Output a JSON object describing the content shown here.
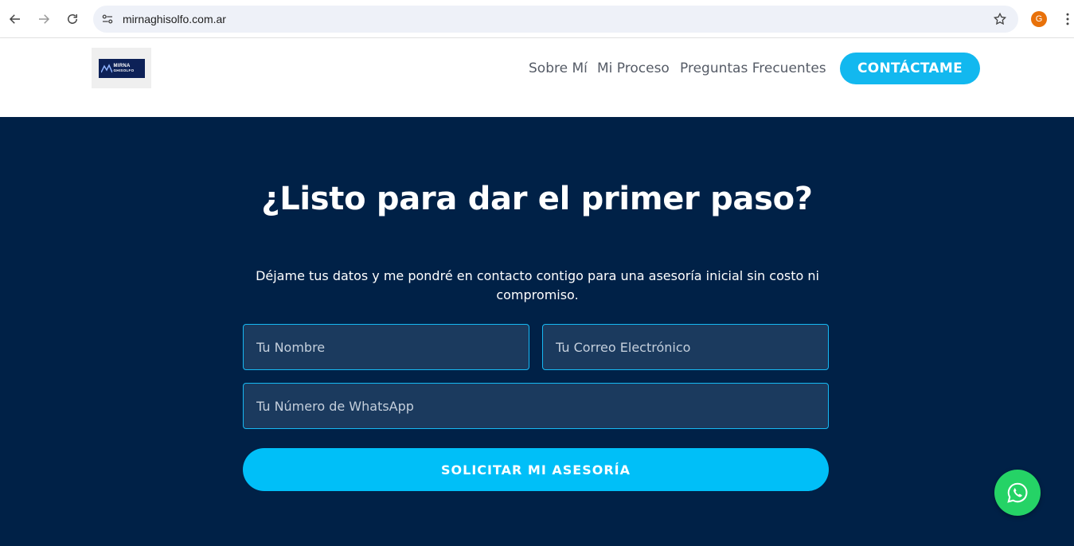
{
  "browser": {
    "url": "mirnaghisolfo.com.ar",
    "profile_initial": "G"
  },
  "header": {
    "logo_line1": "MIRNA",
    "logo_line2": "GHISOLFO",
    "nav": [
      "Sobre Mí",
      "Mi Proceso",
      "Preguntas Frecuentes"
    ],
    "cta_label": "CONTÁCTAME"
  },
  "hero": {
    "title": "¿Listo para dar el primer paso?",
    "subtitle": "Déjame tus datos y me pondré en contacto contigo para una asesoría inicial sin costo ni compromiso.",
    "form": {
      "name_placeholder": "Tu Nombre",
      "email_placeholder": "Tu Correo Electrónico",
      "whatsapp_placeholder": "Tu Número de WhatsApp",
      "submit_label": "SOLICITAR MI ASESORÍA"
    }
  },
  "colors": {
    "hero_bg": "#002147",
    "accent": "#00bff8",
    "whatsapp": "#25d366"
  }
}
